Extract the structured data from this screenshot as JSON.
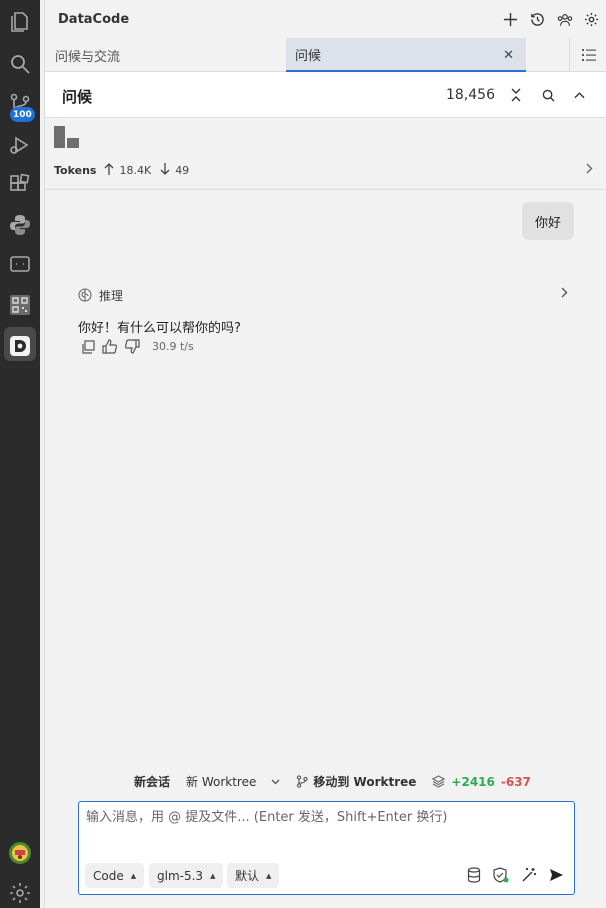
{
  "activity": {
    "badge": "100"
  },
  "titlebar": {
    "title": "DataCode"
  },
  "tabs": [
    {
      "label": "问候与交流"
    },
    {
      "label": "问候"
    }
  ],
  "header": {
    "title": "问候",
    "count": "18,456"
  },
  "stats": {
    "label": "Tokens",
    "up": "18.4K",
    "down": "49"
  },
  "conversation": {
    "user_message": "你好",
    "reasoning_label": "推理",
    "assistant_message": "你好！有什么可以帮你的吗?",
    "speed": "30.9 t/s"
  },
  "footer": {
    "new_session": "新会话",
    "new_worktree": "新 Worktree",
    "move_worktree": "移动到 Worktree",
    "added": "+2416",
    "removed": "-637"
  },
  "composer": {
    "placeholder": "输入消息，用 @ 提及文件... (Enter 发送，Shift+Enter 换行)",
    "mode": "Code",
    "model": "glm-5.3",
    "preset": "默认"
  },
  "colors": {
    "accent": "#2f6fd0",
    "badge": "#1f72d6",
    "added": "#2eaa4f",
    "removed": "#d9534f"
  }
}
